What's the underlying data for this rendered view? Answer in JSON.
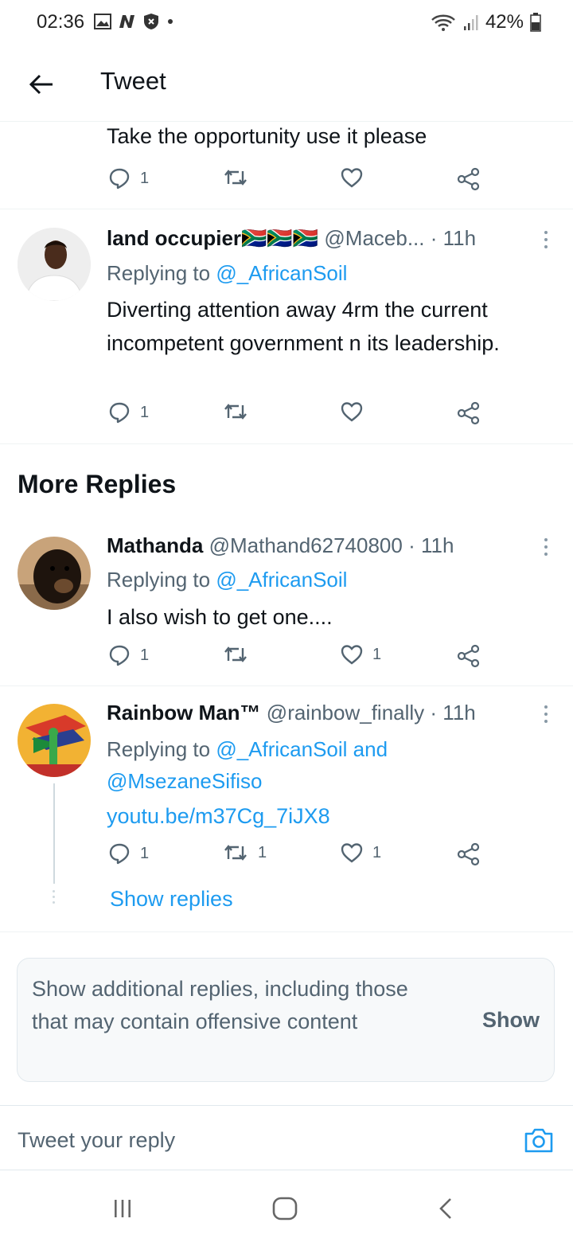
{
  "status_bar": {
    "time": "02:36",
    "battery": "42%"
  },
  "header": {
    "title": "Tweet"
  },
  "previous_tweet": {
    "text": "Take the opportunity use it please",
    "reply_count": "1"
  },
  "tweets": [
    {
      "name": "land occupier",
      "flag_emojis": "🇿🇦🇿🇦🇿🇦",
      "handle": "@Maceb...",
      "time": "· 11h",
      "replying_prefix": "Replying to ",
      "replying_to": "@_AfricanSoil",
      "text": "Diverting attention away 4rm the current incompetent government n its leadership.",
      "reply_count": "1",
      "retweet_count": "",
      "like_count": ""
    },
    {
      "name": "Mathanda",
      "handle": "@Mathand62740800",
      "time": "· 11h",
      "replying_prefix": "Replying to ",
      "replying_to": "@_AfricanSoil",
      "text": "I also wish to get one....",
      "reply_count": "1",
      "retweet_count": "",
      "like_count": "1"
    },
    {
      "name": "Rainbow Man™",
      "handle": "@rainbow_finally",
      "time": "· 11h",
      "replying_prefix": "Replying to ",
      "replying_to": "@_AfricanSoil and",
      "replying_to_2": "@MsezaneSifiso",
      "text": "youtu.be/m37Cg_7iJX8",
      "reply_count": "1",
      "retweet_count": "1",
      "like_count": "1"
    }
  ],
  "section": {
    "more_replies": "More Replies"
  },
  "show_replies": "Show replies",
  "offensive": {
    "text": "Show additional replies, including those that may contain offensive content",
    "button": "Show"
  },
  "composer": {
    "placeholder": "Tweet your reply"
  },
  "colors": {
    "link": "#1d9bf0",
    "secondary_text": "#536471",
    "primary_text": "#0f1419"
  },
  "icons": [
    "back-arrow-icon",
    "reply-icon",
    "retweet-icon",
    "like-icon",
    "share-icon",
    "more-icon",
    "camera-icon",
    "wifi-icon",
    "signal-icon",
    "battery-icon"
  ]
}
